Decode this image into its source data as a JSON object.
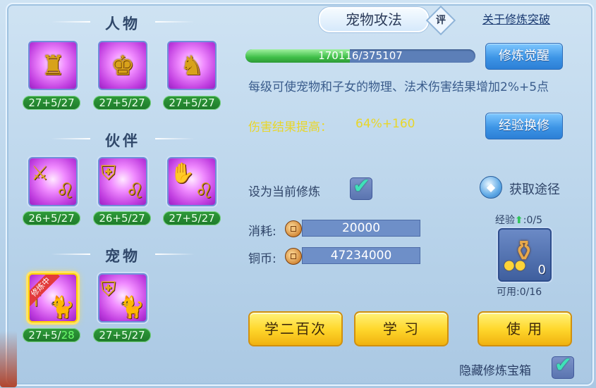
{
  "left": {
    "sections": [
      {
        "title": "人物",
        "slots": [
          {
            "icon": "warrior-meditation-icon",
            "level": "27+5/27"
          },
          {
            "icon": "warrior-shield-icon",
            "level": "27+5/27"
          },
          {
            "icon": "warrior-armor-icon",
            "level": "27+5/27"
          }
        ]
      },
      {
        "title": "伙伴",
        "slots": [
          {
            "icon": "partner-sword-icon",
            "level": "26+5/27"
          },
          {
            "icon": "partner-shield-icon",
            "level": "26+5/27"
          },
          {
            "icon": "partner-glove-icon",
            "level": "27+5/27"
          }
        ]
      },
      {
        "title": "宠物",
        "slots": [
          {
            "icon": "pet-sword-icon",
            "level_prefix": "27+5/",
            "level_suffix": "28",
            "badge": "修炼中",
            "selected": true
          },
          {
            "icon": "pet-shield-icon",
            "level": "27+5/27"
          }
        ]
      }
    ]
  },
  "header": {
    "title": "宠物攻法",
    "eval_label": "评",
    "link": "关于修炼突破"
  },
  "progress": {
    "text": "170116/375107",
    "current": 170116,
    "max": 375107
  },
  "buttons": {
    "awaken": "修炼觉醒",
    "exchange": "经验换修",
    "learn200": "学二百次",
    "learn": "学 习",
    "use": "使 用"
  },
  "description": "每级可使宠物和子女的物理、法术伤害结果增加2%+5点",
  "damage": {
    "label": "伤害结果提高：",
    "value": "64%+160"
  },
  "set_current": {
    "label": "设为当前修炼",
    "checked": true
  },
  "source": {
    "label": "获取途径"
  },
  "cost": {
    "label": "消耗:",
    "value": "20000"
  },
  "coins": {
    "label": "铜币:",
    "value": "47234000"
  },
  "item": {
    "exp_label": "经验",
    "exp_value": ":0/5",
    "count": "0",
    "usable": "可用:0/16"
  },
  "hide_box": {
    "label": "隐藏修炼宝箱",
    "checked": true
  },
  "colors": {
    "damage_text": "#e8d62a",
    "progress_fill": "#3fbf48",
    "level_badge": "#1e7a2a"
  }
}
